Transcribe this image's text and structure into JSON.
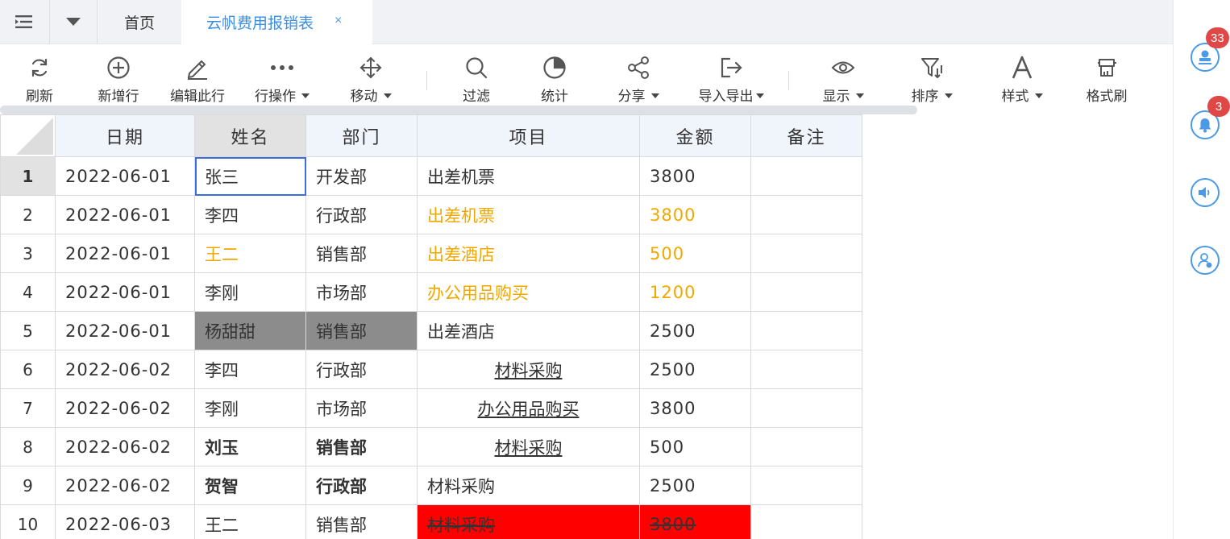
{
  "tabs": {
    "home_label": "首页",
    "active_label": "云帆费用报销表",
    "close_symbol": "×"
  },
  "toolbar": {
    "items": [
      {
        "label": "刷新",
        "icon": "refresh-icon"
      },
      {
        "label": "新增行",
        "icon": "add-circle-icon"
      },
      {
        "label": "编辑此行",
        "icon": "pencil-icon"
      },
      {
        "label": "行操作",
        "icon": "more-icon",
        "dropdown": true
      },
      {
        "label": "移动",
        "icon": "move-icon",
        "dropdown": true
      },
      {
        "label": "过滤",
        "icon": "search-icon"
      },
      {
        "label": "统计",
        "icon": "pie-chart-icon"
      },
      {
        "label": "分享",
        "icon": "share-icon",
        "dropdown": true
      },
      {
        "label": "导入导出",
        "icon": "export-icon",
        "dropdown": true
      },
      {
        "label": "显示",
        "icon": "eye-icon",
        "dropdown": true
      },
      {
        "label": "排序",
        "icon": "sort-filter-icon",
        "dropdown": true
      },
      {
        "label": "样式",
        "icon": "font-style-icon",
        "dropdown": true
      },
      {
        "label": "格式刷",
        "icon": "format-painter-icon"
      }
    ]
  },
  "sidebar": {
    "items": [
      {
        "icon": "stamp-icon",
        "badge": "33"
      },
      {
        "icon": "bell-icon",
        "badge": "3"
      },
      {
        "icon": "speaker-icon",
        "badge": ""
      },
      {
        "icon": "user-settings-icon",
        "badge": ""
      }
    ]
  },
  "sheet": {
    "columns": [
      "日期",
      "姓名",
      "部门",
      "项目",
      "金额",
      "备注"
    ],
    "rows": [
      {
        "n": "1",
        "date": "2022-06-01",
        "name": "张三",
        "dept": "开发部",
        "item": "出差机票",
        "amount": "3800",
        "note": ""
      },
      {
        "n": "2",
        "date": "2022-06-01",
        "name": "李四",
        "dept": "行政部",
        "item": "出差机票",
        "amount": "3800",
        "note": ""
      },
      {
        "n": "3",
        "date": "2022-06-01",
        "name": "王二",
        "dept": "销售部",
        "item": "出差酒店",
        "amount": "500",
        "note": ""
      },
      {
        "n": "4",
        "date": "2022-06-01",
        "name": "李刚",
        "dept": "市场部",
        "item": "办公用品购买",
        "amount": "1200",
        "note": ""
      },
      {
        "n": "5",
        "date": "2022-06-01",
        "name": "杨甜甜",
        "dept": "销售部",
        "item": "出差酒店",
        "amount": "2500",
        "note": ""
      },
      {
        "n": "6",
        "date": "2022-06-02",
        "name": "李四",
        "dept": "行政部",
        "item": "材料采购",
        "amount": "2500",
        "note": ""
      },
      {
        "n": "7",
        "date": "2022-06-02",
        "name": "李刚",
        "dept": "市场部",
        "item": "办公用品购买",
        "amount": "3800",
        "note": ""
      },
      {
        "n": "8",
        "date": "2022-06-02",
        "name": "刘玉",
        "dept": "销售部",
        "item": "材料采购",
        "amount": "500",
        "note": ""
      },
      {
        "n": "9",
        "date": "2022-06-02",
        "name": "贺智",
        "dept": "行政部",
        "item": "材料采购",
        "amount": "2500",
        "note": ""
      },
      {
        "n": "10",
        "date": "2022-06-03",
        "name": "王二",
        "dept": "销售部",
        "item": "材料采购",
        "amount": "3800",
        "note": ""
      }
    ]
  },
  "colors": {
    "accent": "#3c8ee0",
    "highlight_orange": "#f0a800",
    "cell_grey": "#8c8c8c",
    "cell_red": "#ff0000",
    "badge_red": "#e04848",
    "selection": "#3b6fe0"
  }
}
